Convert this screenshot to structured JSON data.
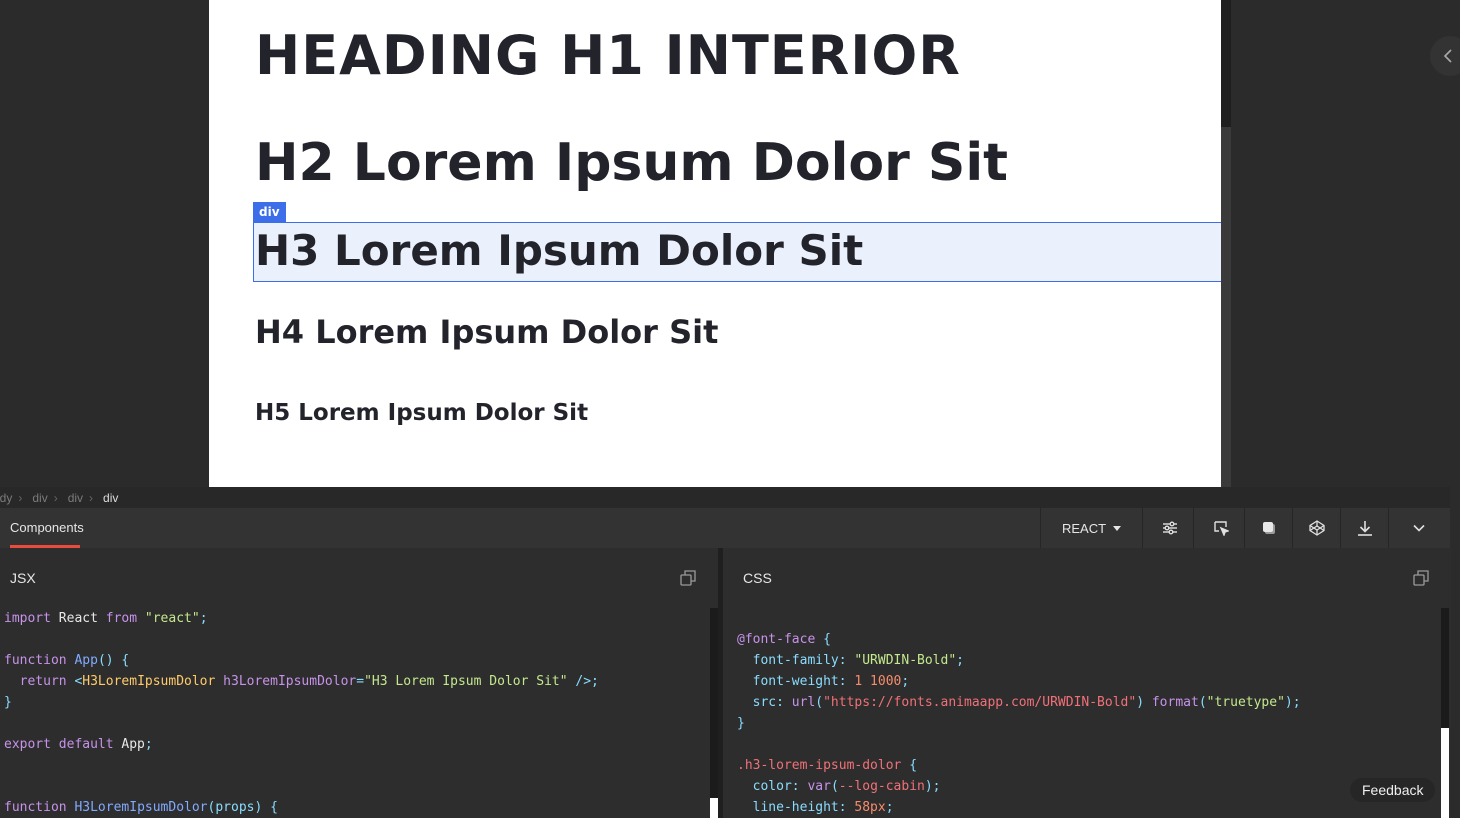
{
  "preview": {
    "h1": "HEADING H1 INTERIOR",
    "h2": "H2 Lorem Ipsum Dolor Sit",
    "h3": "H3 Lorem Ipsum Dolor Sit",
    "h4": "H4 Lorem Ipsum Dolor Sit",
    "h5": "H5 Lorem Ipsum Dolor Sit",
    "selection_tag": "div",
    "text_color": "#22232b",
    "selection_color": "#3b6ee8"
  },
  "breadcrumb": {
    "items": [
      "ody",
      "div",
      "div",
      "div"
    ]
  },
  "toolbar": {
    "tab_label": "Components",
    "framework": "REACT",
    "accent_color": "#e74c3c",
    "icons": [
      "sliders-icon",
      "inspect-cursor-icon",
      "layers-icon",
      "codepen-icon",
      "download-icon",
      "chevron-down-icon"
    ]
  },
  "jsx_panel": {
    "title": "JSX",
    "code": {
      "l1_kw": "import",
      "l1_name": " React ",
      "l1_from": "from",
      "l1_str": "\"react\"",
      "l1_end": ";",
      "l2_kw": "function",
      "l2_fn": " App",
      "l2_end": "() {",
      "l3_kw": "  return ",
      "l3_open": "<",
      "l3_cmp": "H3LoremIpsumDolor",
      "l3_attr": " h3LoremIpsumDolor",
      "l3_eq": "=",
      "l3_str": "\"H3 Lorem Ipsum Dolor Sit\"",
      "l3_close": " />;",
      "l4": "}",
      "l5_kw": "export default",
      "l5_name": " App",
      "l5_end": ";",
      "l6_kw": "function",
      "l6_fn": " H3LoremIpsumDolor",
      "l6_end": "(props) {"
    }
  },
  "css_panel": {
    "title": "CSS",
    "code": {
      "l1_at": "@font-face",
      "l1_end": " {",
      "l2_prop": "  font-family",
      "l2_colon": ": ",
      "l2_val": "\"URWDIN-Bold\"",
      "l2_end": ";",
      "l3_prop": "  font-weight",
      "l3_colon": ": ",
      "l3_val": "1 1000",
      "l3_end": ";",
      "l4_prop": "  src",
      "l4_colon": ": ",
      "l4_fn": "url",
      "l4_open": "(",
      "l4_url": "\"https://fonts.animaapp.com/URWDIN-Bold\"",
      "l4_close": ") ",
      "l4_fn2": "format",
      "l4_open2": "(",
      "l4_fmt": "\"truetype\"",
      "l4_end": ");",
      "l5": "}",
      "l6_sel": ".h3-lorem-ipsum-dolor",
      "l6_end": " {",
      "l7_prop": "  color",
      "l7_colon": ": ",
      "l7_fn": "var",
      "l7_open": "(",
      "l7_var": "--log-cabin",
      "l7_end": ");",
      "l8_prop": "  line-height",
      "l8_colon": ": ",
      "l8_val": "58px",
      "l8_end": ";"
    }
  },
  "feedback": {
    "label": "Feedback"
  }
}
